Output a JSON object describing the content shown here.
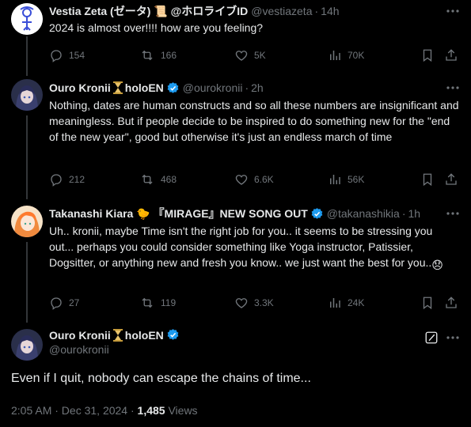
{
  "tweets": [
    {
      "name": "Vestia Zeta (ゼータ) 📜 @ホロライブID",
      "handle": "@vestiazeta",
      "time": "14h",
      "text": "2024 is almost over!!!! how are you feeling?",
      "replies": "154",
      "reposts": "166",
      "likes": "5K",
      "views": "70K"
    },
    {
      "name": "Ouro Kronii",
      "name_suffix": "holoEN",
      "handle": "@ourokronii",
      "time": "2h",
      "text": "Nothing, dates are human constructs and so all these numbers are insignificant and meaningless. But if people decide to be inspired to do something new for the \"end of the new year\", good but otherwise it's just an endless march of time",
      "replies": "212",
      "reposts": "468",
      "likes": "6.6K",
      "views": "56K"
    },
    {
      "name": "Takanashi Kiara 🐤 『MIRAGE』NEW SONG OUT",
      "handle": "@takanashikia",
      "time": "1h",
      "text": "Uh.. kronii, maybe Time isn't the right job for you.. it seems to be stressing you out... perhaps you could consider something like Yoga instructor, Patissier, Dogsitter, or anything new and fresh you know.. we just want the best for you..",
      "emoji": "😞",
      "replies": "27",
      "reposts": "119",
      "likes": "3.3K",
      "views": "24K"
    }
  ],
  "main": {
    "name": "Ouro Kronii",
    "name_suffix": "holoEN",
    "handle": "@ourokronii",
    "text": "Even if I quit, nobody can escape the chains of time...",
    "timestamp": "2:05 AM · Dec 31, 2024 · ",
    "views_count": "1,485",
    "views_label": " Views"
  },
  "colors": {
    "background": "#000000",
    "text": "#e7e9ea",
    "muted": "#71767b",
    "verified": "#1d9bf0",
    "divider": "#333639"
  }
}
